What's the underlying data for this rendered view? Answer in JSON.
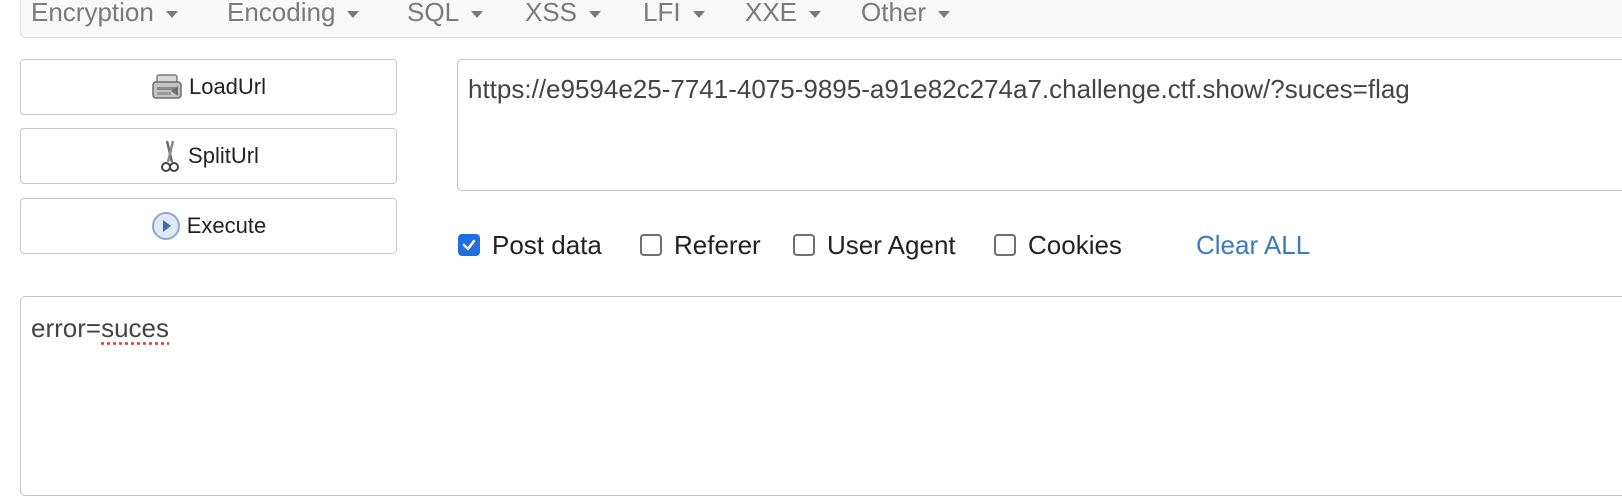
{
  "menu": {
    "items": [
      {
        "label": "Encryption"
      },
      {
        "label": "Encoding"
      },
      {
        "label": "SQL"
      },
      {
        "label": "XSS"
      },
      {
        "label": "LFI"
      },
      {
        "label": "XXE"
      },
      {
        "label": "Other"
      }
    ]
  },
  "buttons": {
    "load_url": "LoadUrl",
    "split_url": "SplitUrl",
    "execute": "Execute"
  },
  "url_field": {
    "value": "https://e9594e25-7741-4075-9895-a91e82c274a7.challenge.ctf.show/?suces=flag"
  },
  "options": {
    "post_data": {
      "label": "Post data",
      "checked": true
    },
    "referer": {
      "label": "Referer",
      "checked": false
    },
    "user_agent": {
      "label": "User Agent",
      "checked": false
    },
    "cookies": {
      "label": "Cookies",
      "checked": false
    }
  },
  "clear_all_label": "Clear ALL",
  "post_field": {
    "prefix": "error=",
    "misspelled": "suces"
  },
  "colors": {
    "checkbox_checked": "#1f6fde",
    "link": "#3a7bc0",
    "spellcheck_underline": "#e0403a"
  },
  "icons": {
    "load_url": "load-url-icon",
    "split_url": "scissors-icon",
    "execute": "play-icon",
    "menu_caret": "caret-down-icon"
  }
}
